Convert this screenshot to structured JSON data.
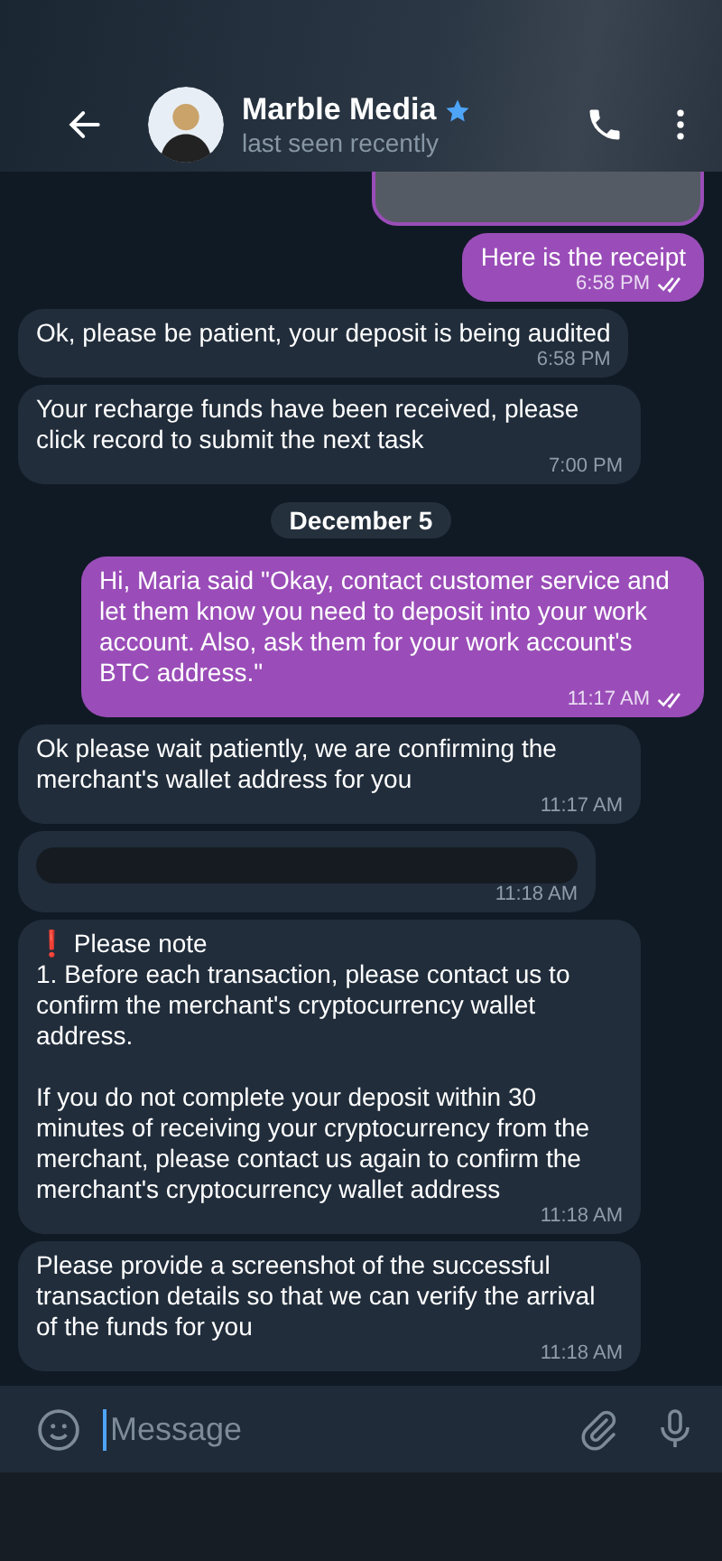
{
  "header": {
    "name": "Marble Media",
    "verified": true,
    "status": "last seen recently"
  },
  "messages": [
    {
      "kind": "stub",
      "outgoing": true
    },
    {
      "kind": "text",
      "outgoing": true,
      "text": "Here is the receipt",
      "time": "6:58 PM",
      "read": true
    },
    {
      "kind": "text",
      "outgoing": false,
      "text": "Ok, please be patient, your deposit is being audited",
      "time": "6:58 PM"
    },
    {
      "kind": "text",
      "outgoing": false,
      "text": "Your recharge funds have been received, please click record to submit the next task",
      "time": "7:00 PM"
    },
    {
      "kind": "date",
      "text": "December 5"
    },
    {
      "kind": "text",
      "outgoing": true,
      "text": "Hi, Maria said \"Okay, contact customer service and let them know you need to deposit into your work account. Also, ask them for your work account's BTC address.\"",
      "time": "11:17 AM",
      "read": true
    },
    {
      "kind": "text",
      "outgoing": false,
      "text": "Ok please wait patiently, we are confirming the merchant's wallet address for you",
      "time": "11:17 AM"
    },
    {
      "kind": "redacted",
      "outgoing": false,
      "time": "11:18 AM"
    },
    {
      "kind": "text",
      "outgoing": false,
      "text": "❗ Please note\n1. Before each transaction, please contact us to confirm the merchant's cryptocurrency wallet address.\n\nIf you do not complete your deposit within 30 minutes of receiving your cryptocurrency from the merchant, please contact us again to confirm the merchant's cryptocurrency wallet address",
      "time": "11:18 AM"
    },
    {
      "kind": "text",
      "outgoing": false,
      "text": "Please provide a screenshot of the successful transaction details so that we can verify the arrival of the funds for you",
      "time": "11:18 AM"
    }
  ],
  "composer": {
    "placeholder": "Message"
  }
}
